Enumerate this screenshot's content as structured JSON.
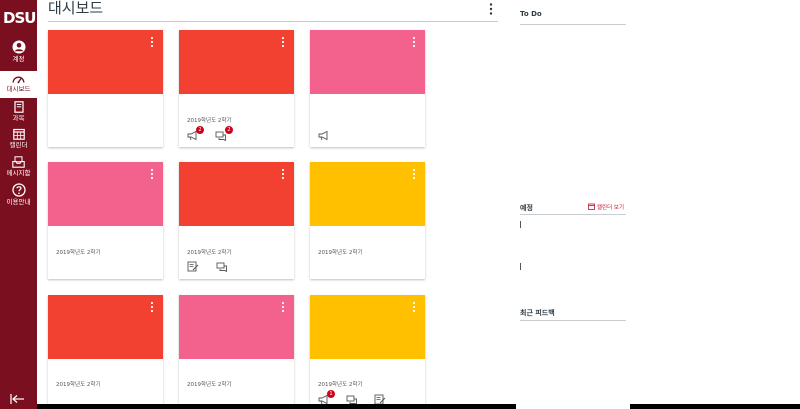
{
  "brand": {
    "logo_text": "DSU",
    "nav_color": "#7a0f1f",
    "accent": "#c8102e"
  },
  "nav": {
    "items": [
      {
        "label": "계정",
        "icon": "account-avatar-icon"
      },
      {
        "label": "대시보드",
        "icon": "dashboard-icon",
        "active": true
      },
      {
        "label": "과목",
        "icon": "book-icon"
      },
      {
        "label": "캘린더",
        "icon": "calendar-icon"
      },
      {
        "label": "메시지함",
        "icon": "inbox-icon"
      },
      {
        "label": "이용안내",
        "icon": "help-icon"
      }
    ],
    "collapse_icon": "collapse-arrow-icon"
  },
  "header": {
    "title": "대시보드",
    "menu_icon": "kebab-icon"
  },
  "cards": [
    {
      "color": "#f24130",
      "term": "",
      "actions": []
    },
    {
      "color": "#f24130",
      "term": "2019학년도 2학기",
      "actions": [
        "announcement-icon",
        "discussion-icon"
      ],
      "badges": [
        "2",
        "2"
      ]
    },
    {
      "color": "#f2628c",
      "term": "",
      "actions": [
        "announcement-icon"
      ]
    },
    {
      "color": "#f2628c",
      "term": "2019학년도 2학기",
      "actions": []
    },
    {
      "color": "#f24130",
      "term": "2019학년도 2학기",
      "actions": [
        "assignment-icon",
        "discussion-icon"
      ]
    },
    {
      "color": "#ffc000",
      "term": "2019학년도 2학기",
      "actions": []
    },
    {
      "color": "#f24130",
      "term": "2019학년도 2학기",
      "actions": []
    },
    {
      "color": "#f2628c",
      "term": "2019학년도 2학기",
      "actions": []
    },
    {
      "color": "#ffc000",
      "term": "2019학년도 2학기",
      "actions": [
        "announcement-icon",
        "discussion-icon",
        "assignment-icon"
      ],
      "badges": [
        "1"
      ]
    }
  ],
  "sidebar": {
    "todo_title": "To Do",
    "coming_up_title": "예정",
    "calendar_link": "캘린더 보기",
    "feedback_title": "최근 피드백"
  }
}
